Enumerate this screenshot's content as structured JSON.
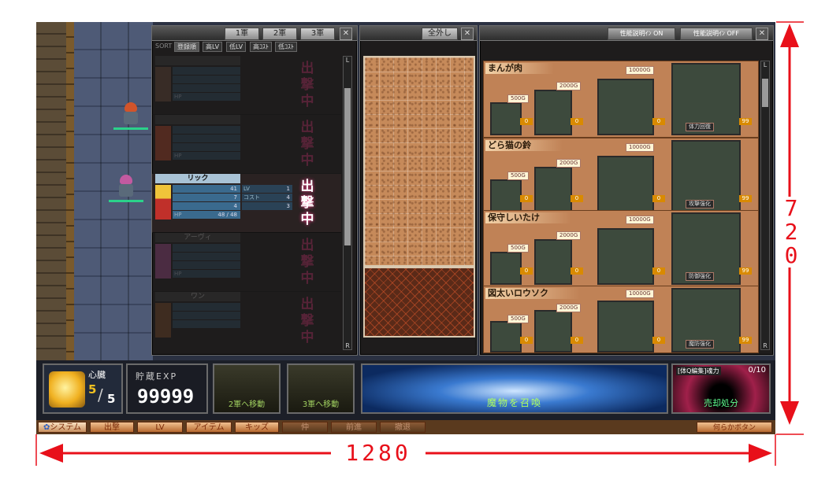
{
  "dimension_labels": {
    "width": "1280",
    "height": "720"
  },
  "units_panel": {
    "tabs": [
      "1軍",
      "2軍",
      "3軍"
    ],
    "sort_label": "SORT",
    "sort_options": [
      "登録順",
      "高LV",
      "低LV",
      "高ｺｽﾄ",
      "低ｺｽﾄ"
    ],
    "characters": [
      {
        "name": "",
        "stats": [
          "",
          "",
          "",
          "HP"
        ],
        "lv_rows": [
          [
            "",
            ""
          ],
          [
            "",
            ""
          ],
          [
            "",
            ""
          ]
        ],
        "status": "出撃中",
        "dim": true
      },
      {
        "name": "",
        "stats": [
          "",
          "",
          "",
          "HP"
        ],
        "lv_rows": [
          [
            "",
            ""
          ],
          [
            "",
            ""
          ],
          [
            "",
            ""
          ]
        ],
        "status": "出撃中",
        "dim": true
      },
      {
        "name": "リック",
        "stats": [
          "",
          "",
          "",
          "HP"
        ],
        "stat_values": [
          "41",
          "7",
          "4",
          "48 / 48"
        ],
        "lv_rows": [
          [
            "LV",
            "1"
          ],
          [
            "コスト",
            "4"
          ],
          [
            "",
            "3"
          ]
        ],
        "status": "出撃中",
        "dim": false
      },
      {
        "name": "アーヴィ",
        "stats": [
          "",
          "",
          "",
          "HP"
        ],
        "lv_rows": [
          [
            "",
            ""
          ],
          [
            "",
            ""
          ],
          [
            "",
            ""
          ]
        ],
        "status": "出撃中",
        "dim": true
      },
      {
        "name": "ワン",
        "stats": [
          "",
          "",
          "",
          ""
        ],
        "lv_rows": [
          [
            "",
            ""
          ],
          [
            "",
            ""
          ],
          [
            "",
            ""
          ]
        ],
        "status": "出撃中",
        "dim": true
      }
    ],
    "scroll_top": "L",
    "scroll_bottom": "R"
  },
  "grid_panel": {
    "button": "全外し"
  },
  "items_panel": {
    "toggle_on": "性能説明ｲﾝ ON",
    "toggle_off": "性能説明ｲﾝ OFF",
    "items": [
      {
        "name": "まんが肉",
        "costs": [
          "500G",
          "2000G",
          "10000G"
        ],
        "effect": "体力回復",
        "color": "#b35a3a"
      },
      {
        "name": "どら猫の鈴",
        "costs": [
          "500G",
          "2000G",
          "10000G"
        ],
        "effect": "攻撃強化",
        "color": "#e0b02a"
      },
      {
        "name": "保守しいたけ",
        "costs": [
          "500G",
          "2000G",
          "10000G"
        ],
        "effect": "防御強化",
        "color": "#5a3222"
      },
      {
        "name": "図太いロウソク",
        "costs": [
          "500G",
          "2000G",
          "10000G"
        ],
        "effect": "魔防強化",
        "color": "#c0501e"
      }
    ],
    "level_values": [
      "0",
      "0",
      "0",
      "99"
    ],
    "scroll_top": "L",
    "scroll_bottom": "R"
  },
  "hud": {
    "heart_label": "心臓",
    "heart_current": "5",
    "heart_max": "5",
    "exp_label": "貯蔵EXP",
    "exp_value": "99999",
    "move_to_2": "2軍へ移動",
    "move_to_3": "3軍へ移動",
    "center_label": "魔物を召喚",
    "right_label": "[体Q編集]魂力",
    "right_count": "0/10",
    "right_button": "売却処分"
  },
  "menu": {
    "system": "システム",
    "buttons": [
      "出撃",
      "LV",
      "アイテム",
      "キッズ"
    ],
    "dark_buttons": [
      "仲",
      "前進",
      "撤退"
    ],
    "right_button": "何らかボタン"
  }
}
